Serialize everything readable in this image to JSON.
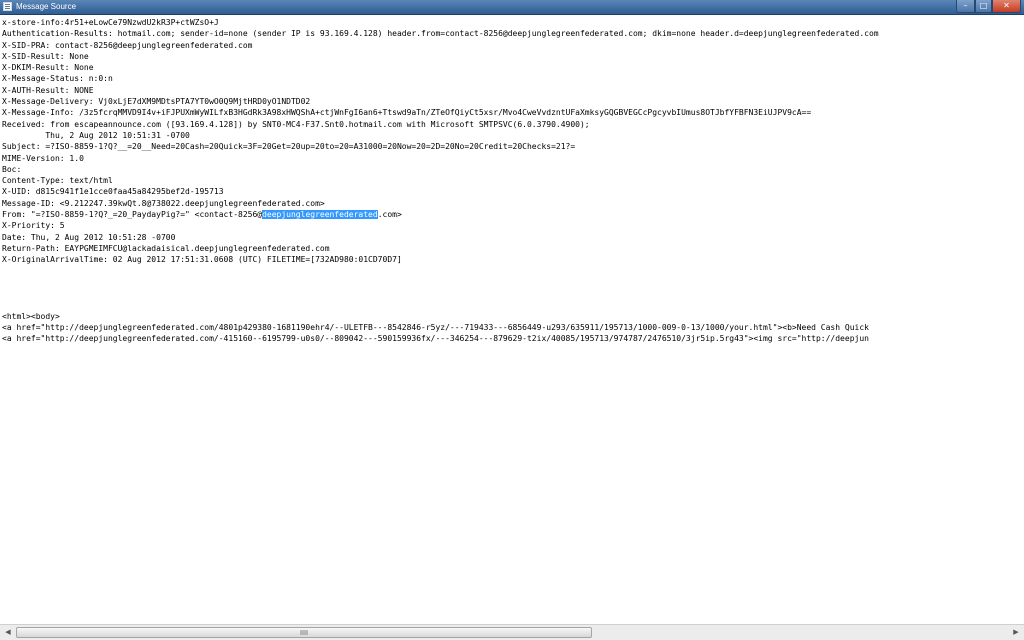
{
  "window": {
    "title": "Message Source",
    "buttons": {
      "minimize": "–",
      "maximize": "□",
      "close": "✕"
    }
  },
  "source": {
    "lines": [
      "x-store-info:4r51+eLowCe79NzwdU2kR3P+ctWZsO+J",
      "Authentication-Results: hotmail.com; sender-id=none (sender IP is 93.169.4.128) header.from=contact-8256@deepjunglegreenfederated.com; dkim=none header.d=deepjunglegreenfederated.com",
      "X-SID-PRA: contact-8256@deepjunglegreenfederated.com",
      "X-SID-Result: None",
      "X-DKIM-Result: None",
      "X-Message-Status: n:0:n",
      "X-AUTH-Result: NONE",
      "X-Message-Delivery: Vj0xLjE7dXM9MDtsPTA7YT0wO0Q9MjtHRD0yO1NDTD02",
      "X-Message-Info: /3z5fcrqMMVD9I4v+iFJPUXmWyWILfxB3HGdRk3A98xHWQShA+ctjWnFgI6an6+Ttswd9aTn/ZTeOfQiyCt5xsr/Mvo4CweVvdzntUFaXmksyGQGBVEGCcPgcyvbIUmus8OTJbfYFBFN3EiUJPV9cA==",
      "Received: from escapeannounce.com ([93.169.4.128]) by SNT0-MC4-F37.Snt0.hotmail.com with Microsoft SMTPSVC(6.0.3790.4900);",
      "\t Thu, 2 Aug 2012 10:51:31 -0700",
      "Subject: =?ISO-8859-1?Q?__=20__Need=20Cash=20Quick=3F=20Get=20up=20to=20=A31000=20Now=20=2D=20No=20Credit=20Checks=21?=",
      "MIME-Version: 1.0",
      "Boc:",
      "Content-Type: text/html",
      "X-UID: d815c941f1e1cce0faa45a84295bef2d-195713",
      "Message-ID: <9.212247.39kwQt.8@738022.deepjunglegreenfederated.com>"
    ],
    "from_line": {
      "prefix": "From: \"=?ISO-8859-1?Q?_=20_PaydayPig?=\" <contact-8256@",
      "selected": "deepjunglegreenfederated",
      "suffix": ".com>"
    },
    "lines_after": [
      "X-Priority: 5",
      "Date: Thu, 2 Aug 2012 10:51:28 -0700",
      "Return-Path: EAYPGMEIMFCU@lackadaisical.deepjunglegreenfederated.com",
      "X-OriginalArrivalTime: 02 Aug 2012 17:51:31.0608 (UTC) FILETIME=[732AD980:01CD70D7]",
      "",
      "",
      "",
      "",
      "<html><body>",
      "<a href=\"http://deepjunglegreenfederated.com/4801p429380-1681190ehr4/--ULETFB---8542846-r5yz/---719433---6856449-u293/635911/195713/1000-009-0-13/1000/your.html\"><b>Need Cash Quick",
      "<a href=\"http://deepjunglegreenfederated.com/-415160--6195799-u0s0/--809042---590159936fx/---346254---879629-t2ix/40085/195713/974787/2476510/3jr5ip.5rg43\"><img src=\"http://deepjun"
    ]
  },
  "scrollbar": {
    "left_arrow": "◀",
    "right_arrow": "▶",
    "position": 0.0,
    "visible_fraction": 0.56
  }
}
